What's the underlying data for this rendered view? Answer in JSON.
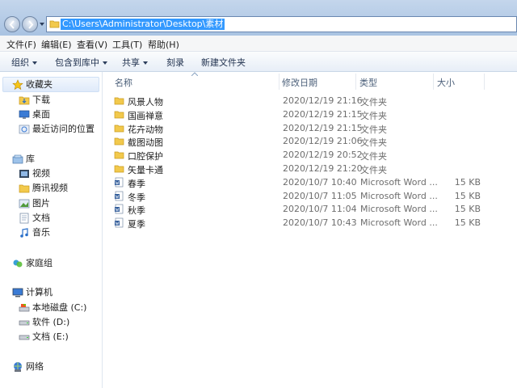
{
  "address": {
    "path": "C:\\Users\\Administrator\\Desktop\\素材"
  },
  "menu": [
    "文件(F)",
    "编辑(E)",
    "查看(V)",
    "工具(T)",
    "帮助(H)"
  ],
  "commands": {
    "organize": "组织",
    "include_library": "包含到库中",
    "share": "共享",
    "burn": "刻录",
    "new_folder": "新建文件夹"
  },
  "columns": {
    "name": "名称",
    "date": "修改日期",
    "type": "类型",
    "size": "大小"
  },
  "nav": {
    "favorites": "收藏夹",
    "downloads": "下载",
    "desktop": "桌面",
    "recent": "最近访问的位置",
    "libraries": "库",
    "videos": "视频",
    "tencent_video": "腾讯视频",
    "pictures": "图片",
    "documents": "文档",
    "music": "音乐",
    "homegroup": "家庭组",
    "computer": "计算机",
    "drive_c": "本地磁盘 (C:)",
    "drive_d": "软件 (D:)",
    "drive_e": "文档 (E:)",
    "network": "网络"
  },
  "files": [
    {
      "name": "风景人物",
      "date": "2020/12/19 21:16",
      "type": "文件夹",
      "size": "",
      "icon": "folder-icon"
    },
    {
      "name": "国画禅意",
      "date": "2020/12/19 21:15",
      "type": "文件夹",
      "size": "",
      "icon": "folder-icon"
    },
    {
      "name": "花卉动物",
      "date": "2020/12/19 21:15",
      "type": "文件夹",
      "size": "",
      "icon": "folder-icon"
    },
    {
      "name": "截图动图",
      "date": "2020/12/19 21:06",
      "type": "文件夹",
      "size": "",
      "icon": "folder-icon"
    },
    {
      "name": "口腔保护",
      "date": "2020/12/19 20:52",
      "type": "文件夹",
      "size": "",
      "icon": "folder-icon"
    },
    {
      "name": "矢量卡通",
      "date": "2020/12/19 21:20",
      "type": "文件夹",
      "size": "",
      "icon": "folder-icon"
    },
    {
      "name": "春季",
      "date": "2020/10/7 10:40",
      "type": "Microsoft Word ...",
      "size": "15 KB",
      "icon": "word-doc-icon"
    },
    {
      "name": "冬季",
      "date": "2020/10/7 11:05",
      "type": "Microsoft Word ...",
      "size": "15 KB",
      "icon": "word-doc-icon"
    },
    {
      "name": "秋季",
      "date": "2020/10/7 11:04",
      "type": "Microsoft Word ...",
      "size": "15 KB",
      "icon": "word-doc-icon"
    },
    {
      "name": "夏季",
      "date": "2020/10/7 10:43",
      "type": "Microsoft Word ...",
      "size": "15 KB",
      "icon": "word-doc-icon"
    }
  ],
  "colors": {
    "selection": "#3399ff",
    "chrome": "#c4d6ec",
    "folder": "#f2c94c"
  }
}
